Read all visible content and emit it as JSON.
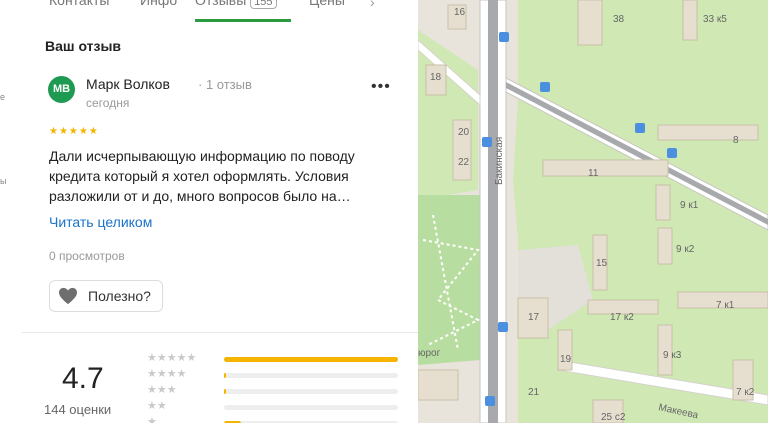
{
  "left_strip": {
    "frag1": "е",
    "frag2": "ы"
  },
  "tabs": [
    {
      "label": "Контакты"
    },
    {
      "label": "Инфо"
    },
    {
      "label": "Отзывы",
      "badge": "155"
    },
    {
      "label": "Цены"
    }
  ],
  "review": {
    "section_title": "Ваш отзыв",
    "avatar_initials": "МВ",
    "author": "Марк Волков",
    "author_reviews": "· 1 отзыв",
    "date": "сегодня",
    "stars": "★★★★★",
    "text": "Дали исчерпывающую информацию по поводу кредита который я хотел оформлять. Условия разложили от и до, много вопросов было на…",
    "read_more": "Читать целиком",
    "views": "0 просмотров",
    "useful_label": "Полезно?"
  },
  "rating": {
    "score": "4.7",
    "count_label": "144 оценки",
    "distribution": [
      {
        "stars": "★★★★★",
        "fill": 1.0
      },
      {
        "stars": "★★★★",
        "fill": 0.01
      },
      {
        "stars": "★★★",
        "fill": 0.01
      },
      {
        "stars": "★★",
        "fill": 0.0
      },
      {
        "stars": "★",
        "fill": 0.1
      }
    ]
  },
  "map": {
    "street_bakinskaya": "Бакинская",
    "street_makeeva": "Макеева",
    "buildings": [
      "16",
      "38",
      "33 к5",
      "18",
      "20",
      "22",
      "11",
      "8",
      "9 к1",
      "9 к2",
      "15",
      "17",
      "17 к2",
      "7 к1",
      "19",
      "9 к3",
      "7 к2",
      "25 с2",
      "21",
      "юрог"
    ]
  }
}
